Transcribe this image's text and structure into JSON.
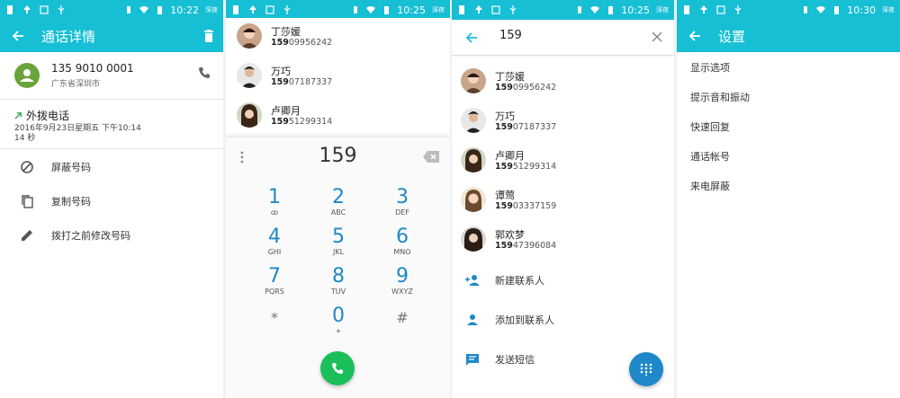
{
  "colors": {
    "accent": "#17bfd5",
    "dial_digit": "#1e88c8",
    "call_fab": "#1bbf5a",
    "pad_fab": "#1e88c8"
  },
  "panel1": {
    "status": {
      "time": "10:22",
      "tag": "深夜"
    },
    "title": "通话详情",
    "contact": {
      "number": "135 9010 0001",
      "location": "广东省深圳市"
    },
    "call": {
      "type": "外拨电话",
      "datetime": "2016年9月23日星期五 下午10:14",
      "duration": "14 秒"
    },
    "actions": [
      {
        "label": "屏蔽号码",
        "icon": "block-icon"
      },
      {
        "label": "复制号码",
        "icon": "copy-icon"
      },
      {
        "label": "拨打之前修改号码",
        "icon": "edit-icon"
      }
    ]
  },
  "panel2": {
    "status": {
      "time": "10:25",
      "tag": "深夜"
    },
    "suggestions": [
      {
        "name": "丁莎媛",
        "match": "159",
        "rest": "09956242"
      },
      {
        "name": "万巧",
        "match": "159",
        "rest": "07187337"
      },
      {
        "name": "卢卿月",
        "match": "159",
        "rest": "51299314"
      }
    ],
    "input": "159",
    "keys": [
      {
        "digit": "1",
        "letters": "ꝏ"
      },
      {
        "digit": "2",
        "letters": "ABC"
      },
      {
        "digit": "3",
        "letters": "DEF"
      },
      {
        "digit": "4",
        "letters": "GHI"
      },
      {
        "digit": "5",
        "letters": "JKL"
      },
      {
        "digit": "6",
        "letters": "MNO"
      },
      {
        "digit": "7",
        "letters": "PQRS"
      },
      {
        "digit": "8",
        "letters": "TUV"
      },
      {
        "digit": "9",
        "letters": "WXYZ"
      },
      {
        "digit": "*",
        "letters": ""
      },
      {
        "digit": "0",
        "letters": "+"
      },
      {
        "digit": "#",
        "letters": ""
      }
    ]
  },
  "panel3": {
    "status": {
      "time": "10:25",
      "tag": "深夜"
    },
    "query": "159",
    "results": [
      {
        "name": "丁莎媛",
        "match": "159",
        "rest": "09956242"
      },
      {
        "name": "万巧",
        "match": "159",
        "rest": "07187337"
      },
      {
        "name": "卢卿月",
        "match": "159",
        "rest": "51299314"
      },
      {
        "name": "谭莺",
        "match": "159",
        "rest": "03337159"
      },
      {
        "name": "郭欢梦",
        "match": "159",
        "rest": "47396084"
      }
    ],
    "actions": [
      {
        "label": "新建联系人",
        "icon": "add-contact-icon"
      },
      {
        "label": "添加到联系人",
        "icon": "person-icon"
      },
      {
        "label": "发送短信",
        "icon": "message-icon"
      }
    ]
  },
  "panel4": {
    "status": {
      "time": "10:30",
      "tag": "深夜"
    },
    "title": "设置",
    "items": [
      "显示选项",
      "提示音和振动",
      "快速回复",
      "通话帐号",
      "来电屏蔽"
    ]
  }
}
